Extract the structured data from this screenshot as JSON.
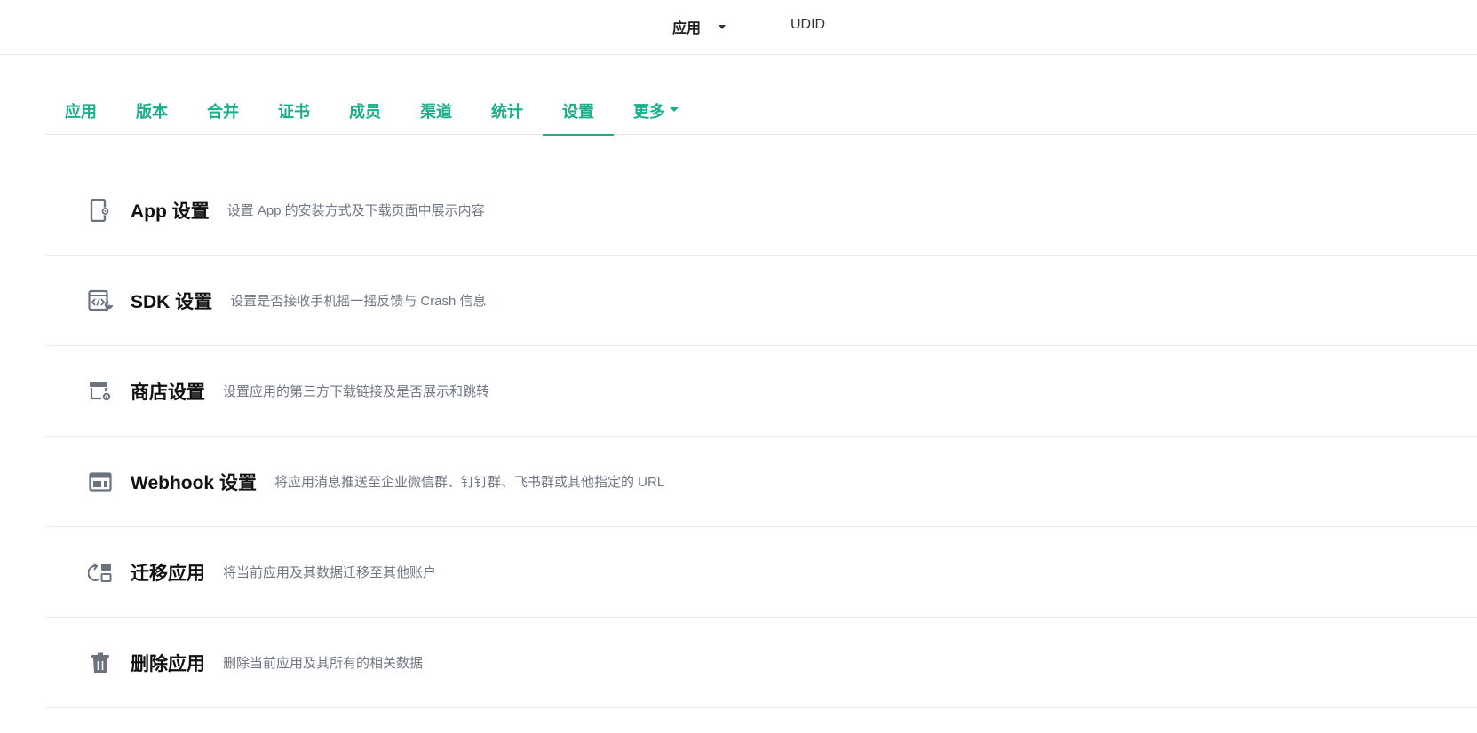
{
  "topbar": {
    "app_label": "应用",
    "udid_label": "UDID"
  },
  "tabs": [
    {
      "label": "应用"
    },
    {
      "label": "版本"
    },
    {
      "label": "合并"
    },
    {
      "label": "证书"
    },
    {
      "label": "成员"
    },
    {
      "label": "渠道"
    },
    {
      "label": "统计"
    },
    {
      "label": "设置",
      "active": true
    },
    {
      "label": "更多",
      "has_dropdown": true
    }
  ],
  "settings": [
    {
      "icon": "app-settings-icon",
      "title": "App 设置",
      "desc": "设置 App 的安装方式及下载页面中展示内容"
    },
    {
      "icon": "sdk-settings-icon",
      "title": "SDK 设置",
      "desc": "设置是否接收手机摇一摇反馈与 Crash 信息"
    },
    {
      "icon": "store-settings-icon",
      "title": "商店设置",
      "desc": "设置应用的第三方下载链接及是否展示和跳转"
    },
    {
      "icon": "webhook-icon",
      "title": "Webhook 设置",
      "desc": "将应用消息推送至企业微信群、钉钉群、飞书群或其他指定的 URL"
    },
    {
      "icon": "migrate-icon",
      "title": "迁移应用",
      "desc": "将当前应用及其数据迁移至其他账户"
    },
    {
      "icon": "trash-icon",
      "title": "删除应用",
      "desc": "删除当前应用及其所有的相关数据"
    }
  ],
  "colors": {
    "accent": "#1aae8a",
    "icon": "#6b7380",
    "desc": "#707784"
  }
}
